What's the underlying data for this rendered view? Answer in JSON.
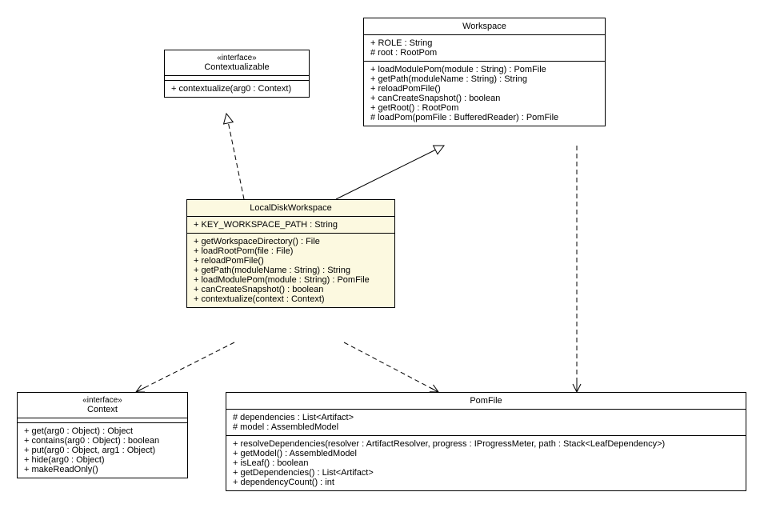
{
  "classes": {
    "contextualizable": {
      "stereotype": "«interface»",
      "name": "Contextualizable",
      "methods": [
        "+ contextualize(arg0 : Context)"
      ]
    },
    "workspace": {
      "name": "Workspace",
      "attrs": [
        "+ ROLE : String",
        "# root : RootPom"
      ],
      "methods": [
        "+ loadModulePom(module : String) : PomFile",
        "+ getPath(moduleName : String) : String",
        "+ reloadPomFile()",
        "+ canCreateSnapshot() : boolean",
        "+ getRoot() : RootPom",
        "# loadPom(pomFile : BufferedReader) : PomFile"
      ]
    },
    "localdiskworkspace": {
      "name": "LocalDiskWorkspace",
      "attrs": [
        "+ KEY_WORKSPACE_PATH : String"
      ],
      "methods": [
        "+ getWorkspaceDirectory() : File",
        "+ loadRootPom(file : File)",
        "+ reloadPomFile()",
        "+ getPath(moduleName : String) : String",
        "+ loadModulePom(module : String) : PomFile",
        "+ canCreateSnapshot() : boolean",
        "+ contextualize(context : Context)"
      ]
    },
    "context": {
      "stereotype": "«interface»",
      "name": "Context",
      "methods": [
        "+ get(arg0 : Object) : Object",
        "+ contains(arg0 : Object) : boolean",
        "+ put(arg0 : Object, arg1 : Object)",
        "+ hide(arg0 : Object)",
        "+ makeReadOnly()"
      ]
    },
    "pomfile": {
      "name": "PomFile",
      "attrs": [
        "# dependencies : List<Artifact>",
        "# model : AssembledModel"
      ],
      "methods": [
        "+ resolveDependencies(resolver : ArtifactResolver, progress : IProgressMeter, path : Stack<LeafDependency>)",
        "+ getModel() : AssembledModel",
        "+ isLeaf() : boolean",
        "+ getDependencies() : List<Artifact>",
        "+ dependencyCount() : int"
      ]
    }
  }
}
